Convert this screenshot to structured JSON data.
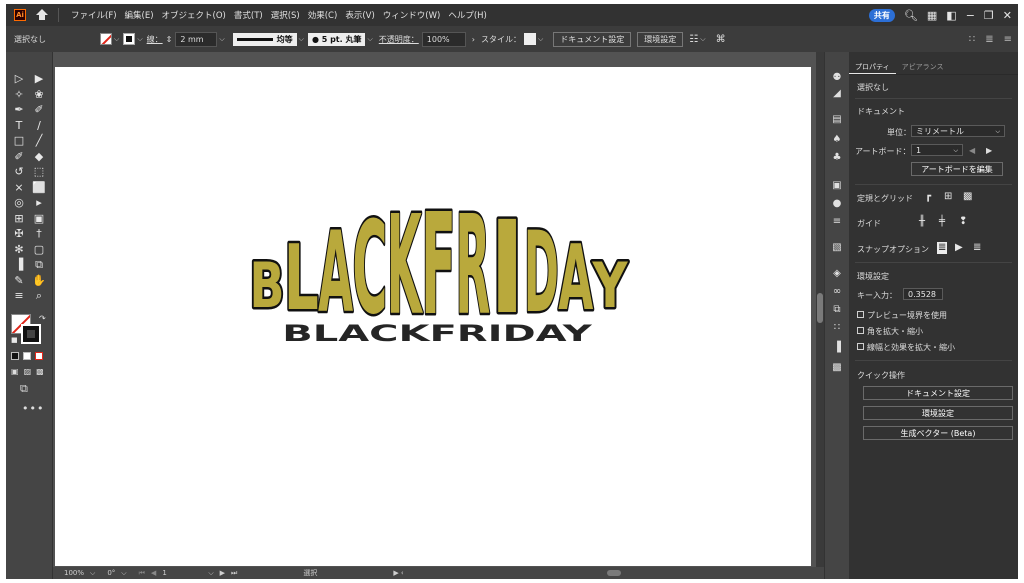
{
  "app": {
    "logo_text": "Ai",
    "menu": [
      "ファイル(F)",
      "編集(E)",
      "オブジェクト(O)",
      "書式(T)",
      "選択(S)",
      "効果(C)",
      "表示(V)",
      "ウィンドウ(W)",
      "ヘルプ(H)"
    ],
    "share_label": "共有"
  },
  "control_bar": {
    "selection_label": "選択なし",
    "stroke_label": "線：",
    "stroke_weight": "2 mm",
    "profile_label": "均等",
    "brush_label": "5 pt. 丸筆",
    "opacity_label": "不透明度：",
    "opacity_value": "100%",
    "style_label": "スタイル：",
    "document_setup_button": "ドキュメント設定",
    "preferences_button": "環境設定"
  },
  "canvas": {
    "artwork_text": "BLACKFRIDAY",
    "artwork_fill": "#b9a93c",
    "artwork_stroke": "#111111"
  },
  "status_bar": {
    "zoom": "100%",
    "rotation": "0°",
    "artboard_number": "1",
    "tool_name": "選択"
  },
  "panel": {
    "tabs": [
      "プロパティ",
      "アピアランス"
    ],
    "no_selection": "選択なし",
    "document_heading": "ドキュメント",
    "units_label": "単位：",
    "units_value": "ミリメートル",
    "artboard_label": "アートボード：",
    "artboard_value": "1",
    "edit_artboard_button": "アートボードを編集",
    "rulers_grids_label": "定規とグリッド",
    "guides_label": "ガイド",
    "snap_options_label": "スナップオプション",
    "preferences_heading": "環境設定",
    "key_increment_label": "キー入力：",
    "key_increment_value": "0.3528 m",
    "preview_bounds_label": "プレビュー境界を使用",
    "scale_corners_label": "角を拡大・縮小",
    "scale_strokes_label": "線幅と効果を拡大・縮小",
    "quick_actions_heading": "クイック操作",
    "document_setup_button": "ドキュメント設定",
    "preferences_button": "環境設定",
    "generative_vector_button": "生成ベクター (Beta)"
  }
}
